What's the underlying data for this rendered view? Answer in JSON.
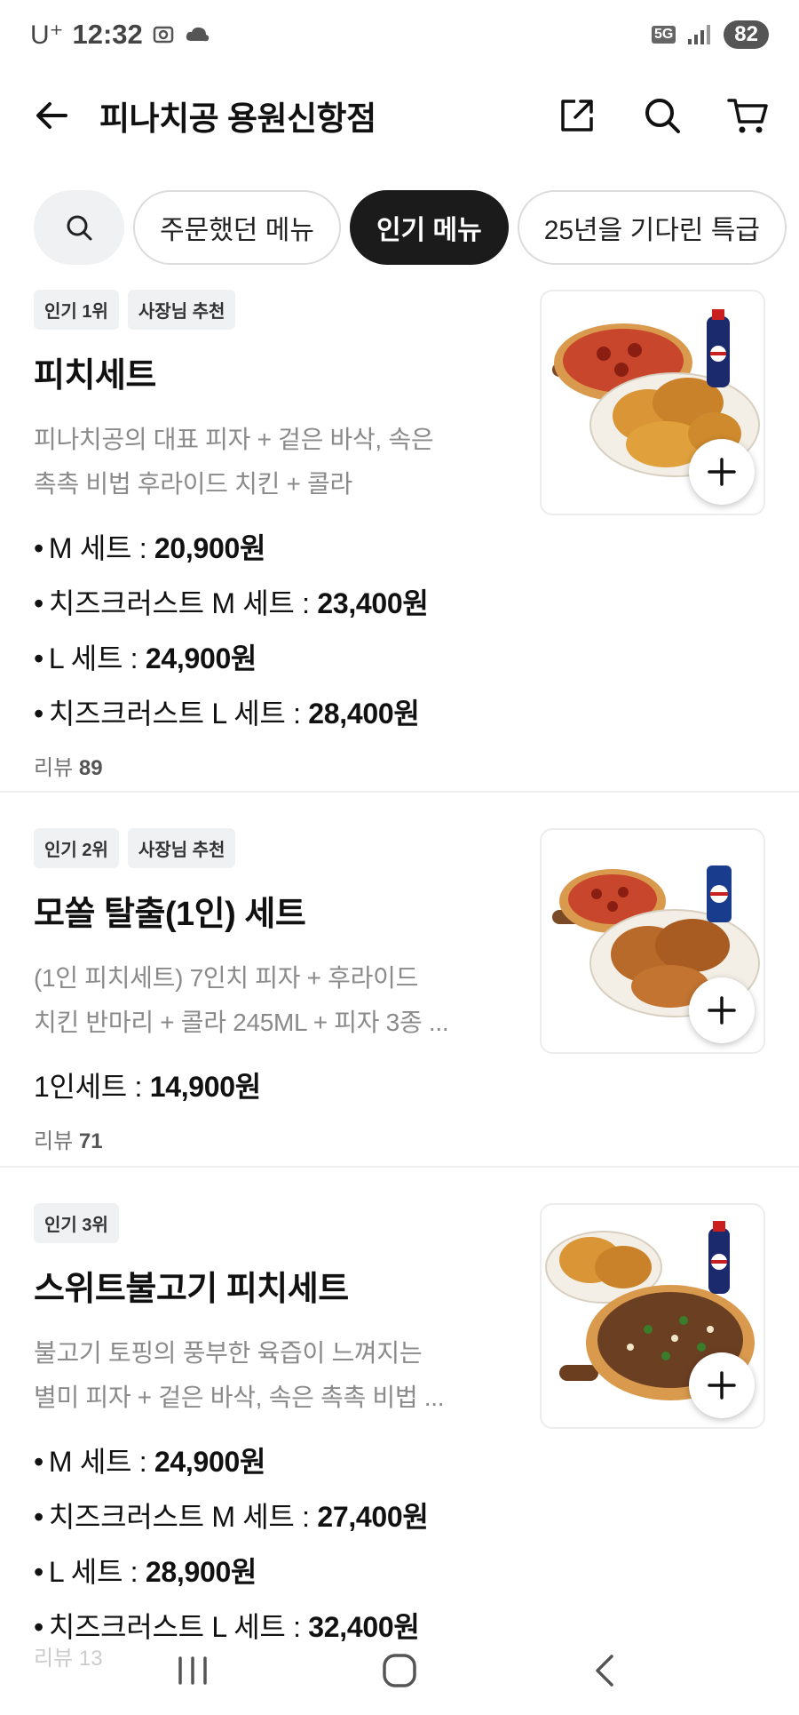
{
  "status_bar": {
    "carrier": "U⁺",
    "time": "12:32",
    "network": "5G",
    "battery": "82"
  },
  "header": {
    "title": "피나치공 용원신항점"
  },
  "chips": [
    "주문했던 메뉴",
    "인기 메뉴",
    "25년을 기다린 특급"
  ],
  "items": [
    {
      "badges": [
        "인기 1위",
        "사장님 추천"
      ],
      "name": "피치세트",
      "desc_lines": [
        "피나치공의 대표 피자 + 겉은 바삭, 속은",
        "촉촉 비법 후라이드 치킨 + 콜라"
      ],
      "prices": [
        {
          "label": "M 세트 : ",
          "price": "20,900원"
        },
        {
          "label": "치즈크러스트 M 세트 : ",
          "price": "23,400원"
        },
        {
          "label": "L 세트 : ",
          "price": "24,900원"
        },
        {
          "label": "치즈크러스트 L 세트 : ",
          "price": "28,400원"
        }
      ],
      "review_label": "리뷰",
      "review_count": "89"
    },
    {
      "badges": [
        "인기 2위",
        "사장님 추천"
      ],
      "name": "모쏠 탈출(1인) 세트",
      "desc_lines": [
        "(1인 피치세트) 7인치 피자 + 후라이드",
        "치킨 반마리 + 콜라 245ML + 피자 3종 ..."
      ],
      "prices": [
        {
          "label": "1인세트 : ",
          "price": "14,900원"
        }
      ],
      "review_label": "리뷰",
      "review_count": "71"
    },
    {
      "badges": [
        "인기 3위"
      ],
      "name": "스위트불고기 피치세트",
      "desc_lines": [
        "불고기 토핑의 풍부한 육즙이 느껴지는",
        "별미 피자 +  겉은 바삭, 속은 촉촉 비법 ..."
      ],
      "prices": [
        {
          "label": "M 세트 : ",
          "price": "24,900원"
        },
        {
          "label": "치즈크러스트 M 세트 : ",
          "price": "27,400원"
        },
        {
          "label": "L 세트 : ",
          "price": "28,900원"
        },
        {
          "label": "치즈크러스트 L 세트 : ",
          "price": "32,400원"
        }
      ],
      "review_label": "리뷰",
      "review_count": "13"
    }
  ],
  "colors": {
    "active_chip": "#1b1b1b",
    "muted_text": "#8a8a8a",
    "badge_bg": "#f0f1f3"
  }
}
